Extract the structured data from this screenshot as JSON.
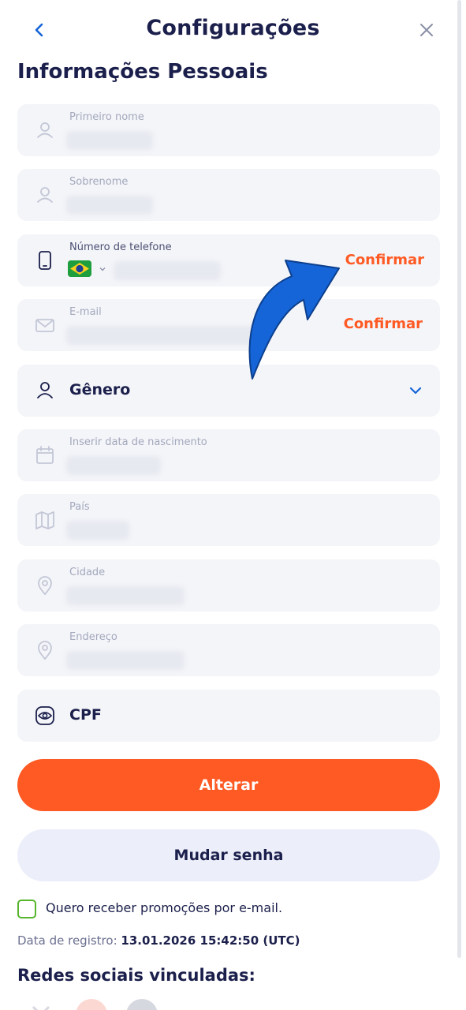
{
  "header": {
    "title": "Configurações",
    "back_icon": "chevron-left-icon",
    "close_icon": "close-icon"
  },
  "section_title": "Informações Pessoais",
  "fields": {
    "first_name": {
      "label": "Primeiro nome",
      "icon": "user-icon"
    },
    "last_name": {
      "label": "Sobrenome",
      "icon": "user-icon"
    },
    "phone": {
      "label": "Número de telefone",
      "icon": "phone-icon",
      "country": "Brazil",
      "confirm_label": "Confirmar"
    },
    "email": {
      "label": "E-mail",
      "icon": "mail-icon",
      "confirm_label": "Confirmar"
    },
    "gender": {
      "label": "Gênero",
      "icon": "user-icon"
    },
    "birth_date": {
      "label": "Inserir data de nascimento",
      "icon": "calendar-icon"
    },
    "country": {
      "label": "País",
      "icon": "map-icon"
    },
    "city": {
      "label": "Cidade",
      "icon": "location-pin-icon"
    },
    "address": {
      "label": "Endereço",
      "icon": "location-pin-icon"
    },
    "cpf": {
      "label": "CPF",
      "icon": "id-badge-icon"
    }
  },
  "buttons": {
    "primary": "Alterar",
    "secondary": "Mudar senha"
  },
  "promo_checkbox": {
    "label": "Quero receber promoções por e-mail.",
    "checked": false
  },
  "registration": {
    "label": "Data de registro:",
    "value": "13.01.2026 15:42:50 (UTC)"
  },
  "social_title": "Redes sociais vinculadas:",
  "colors": {
    "accent": "#ff5a24",
    "text": "#1b1f4b",
    "field_bg": "#f4f5f9",
    "link_blue": "#1565d8",
    "checkbox_green": "#57b52c"
  }
}
